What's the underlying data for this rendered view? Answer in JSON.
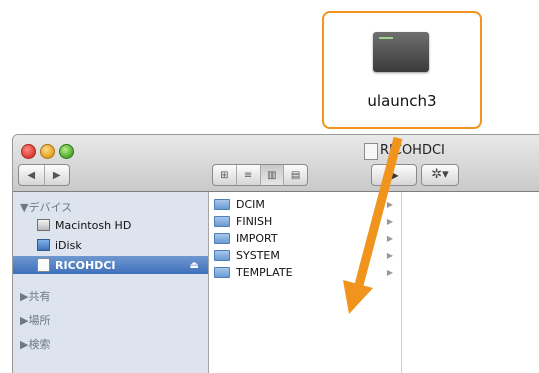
{
  "callout": {
    "app_label": "ulaunch3",
    "icon": "app-thumbnail-icon",
    "border_color": "#f0941e"
  },
  "window": {
    "title": "RICOHDCI",
    "nav_buttons": [
      "◀",
      "▶"
    ],
    "view_buttons": [
      "⊞",
      "≡",
      "▥",
      "▤"
    ],
    "active_view_index": 2,
    "action_glyph": "▶",
    "gear_glyph": "✲▾"
  },
  "sidebar": {
    "devices_header": "▼デバイス",
    "devices": [
      {
        "label": "Macintosh HD",
        "icon": "hard-drive-icon"
      },
      {
        "label": "iDisk",
        "icon": "idisk-icon"
      },
      {
        "label": "RICOHDCI",
        "icon": "sd-card-icon",
        "selected": true,
        "eject": "⏏"
      }
    ],
    "shared_header": "▶共有",
    "places_header": "▶場所",
    "search_header": "▶検索"
  },
  "column": {
    "items": [
      {
        "label": "DCIM"
      },
      {
        "label": "FINISH"
      },
      {
        "label": "IMPORT"
      },
      {
        "label": "SYSTEM"
      },
      {
        "label": "TEMPLATE"
      }
    ],
    "arrow_glyph": "▶"
  },
  "overlay": {
    "arrow_color": "#f0941e"
  }
}
